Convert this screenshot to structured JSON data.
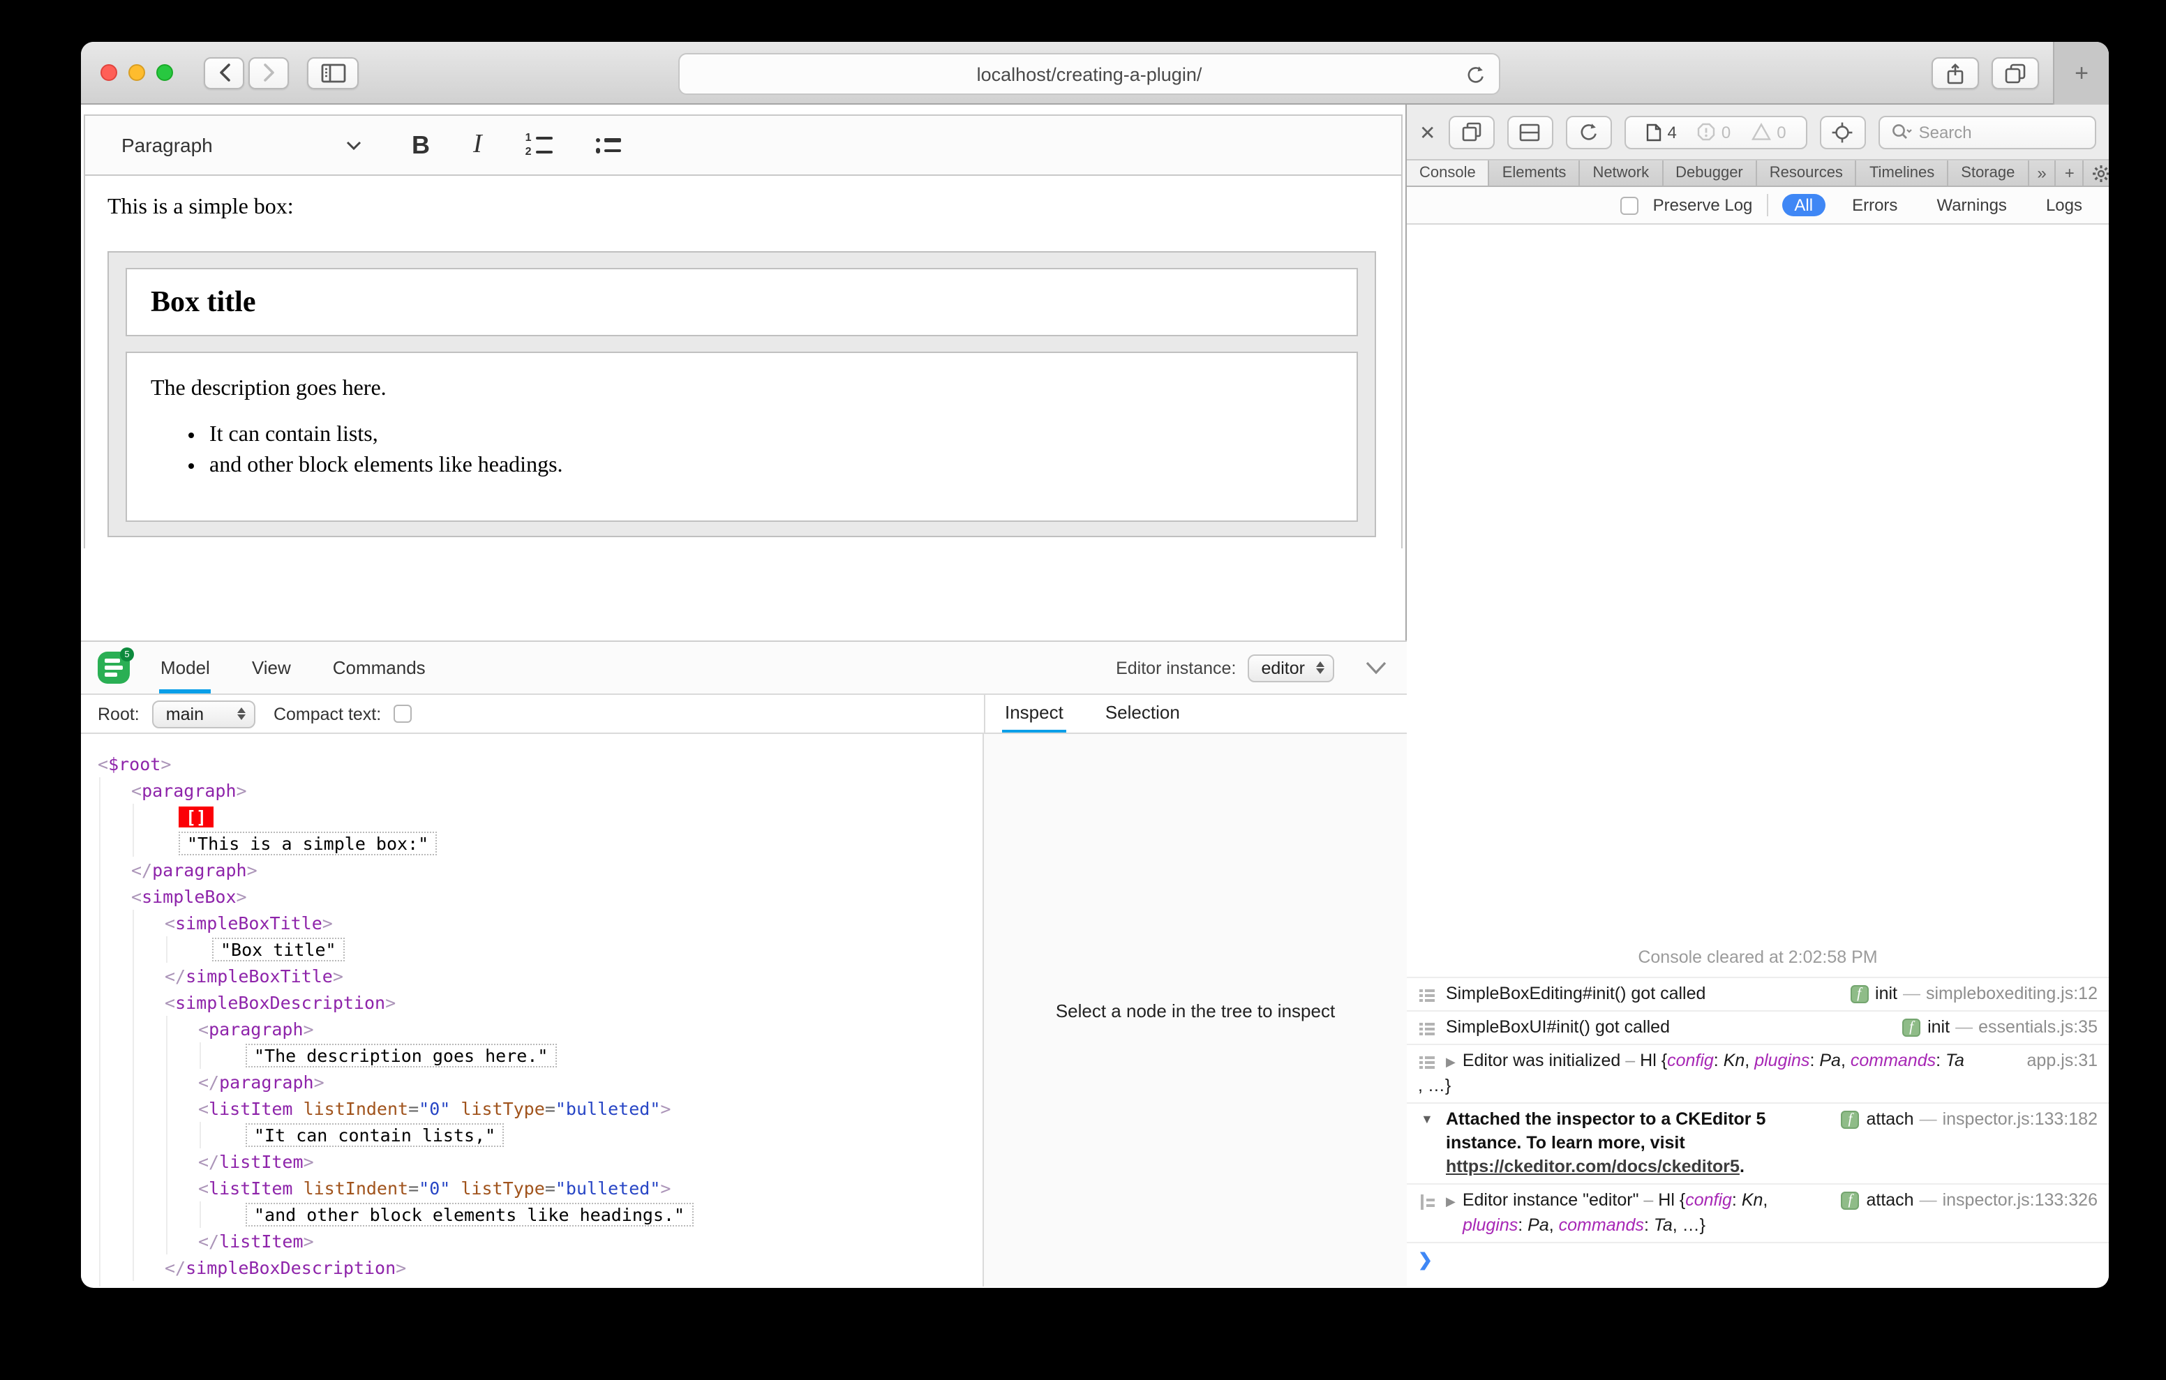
{
  "browser": {
    "url": "localhost/creating-a-plugin/",
    "new_tab_label": "+"
  },
  "editor": {
    "toolbar": {
      "paragraph_label": "Paragraph",
      "bold_label": "B",
      "italic_label": "I"
    },
    "content": {
      "intro": "This is a simple box:",
      "box_title": "Box title",
      "description": "The description goes here.",
      "bullets": [
        "It can contain lists,",
        "and other block elements like headings."
      ]
    }
  },
  "inspector": {
    "logo_badge": "5",
    "tabs": [
      {
        "label": "Model",
        "active": true
      },
      {
        "label": "View",
        "active": false
      },
      {
        "label": "Commands",
        "active": false
      }
    ],
    "editor_instance_label": "Editor instance:",
    "editor_instance_value": "editor",
    "root_label": "Root:",
    "root_value": "main",
    "compact_label": "Compact text:",
    "side_tabs": [
      {
        "label": "Inspect",
        "active": true
      },
      {
        "label": "Selection",
        "active": false
      }
    ],
    "empty_message": "Select a node in the tree to inspect",
    "tree": {
      "tag": "$root",
      "children": [
        {
          "tag": "paragraph",
          "children": [
            {
              "selection": "[]"
            },
            {
              "text": "\"This is a simple box:\""
            }
          ]
        },
        {
          "tag": "simpleBox",
          "children": [
            {
              "tag": "simpleBoxTitle",
              "children": [
                {
                  "text": "\"Box title\""
                }
              ]
            },
            {
              "tag": "simpleBoxDescription",
              "children": [
                {
                  "tag": "paragraph",
                  "children": [
                    {
                      "text": "\"The description goes here.\""
                    }
                  ]
                },
                {
                  "tag": "listItem",
                  "attrs": [
                    {
                      "name": "listIndent",
                      "value": "\"0\""
                    },
                    {
                      "name": "listType",
                      "value": "\"bulleted\""
                    }
                  ],
                  "children": [
                    {
                      "text": "\"It can contain lists,\""
                    }
                  ]
                },
                {
                  "tag": "listItem",
                  "attrs": [
                    {
                      "name": "listIndent",
                      "value": "\"0\""
                    },
                    {
                      "name": "listType",
                      "value": "\"bulleted\""
                    }
                  ],
                  "children": [
                    {
                      "text": "\"and other block elements like headings.\""
                    }
                  ]
                }
              ]
            }
          ]
        }
      ]
    }
  },
  "devtools": {
    "toolbar": {
      "page_count": "4",
      "error_count": "0",
      "warning_count": "0",
      "search_placeholder": "Search"
    },
    "tabs": [
      {
        "label": "Console",
        "active": true
      },
      {
        "label": "Elements",
        "active": false
      },
      {
        "label": "Network",
        "active": false
      },
      {
        "label": "Debugger",
        "active": false
      },
      {
        "label": "Resources",
        "active": false
      },
      {
        "label": "Timelines",
        "active": false
      },
      {
        "label": "Storage",
        "active": false
      }
    ],
    "overflow_label": "»",
    "add_tab_label": "+",
    "filters": {
      "preserve_label": "Preserve Log",
      "scopes": [
        {
          "label": "All",
          "active": true
        },
        {
          "label": "Errors",
          "active": false
        },
        {
          "label": "Warnings",
          "active": false
        },
        {
          "label": "Logs",
          "active": false
        }
      ]
    },
    "console": {
      "cleared": "Console cleared at 2:02:58 PM",
      "prompt": "❯",
      "entries": [
        {
          "icon": "log",
          "lines": [
            {
              "ind": 0,
              "segs": [
                {
                  "s": "plain",
                  "t": "SimpleBoxEditing#init() got called"
                }
              ]
            }
          ],
          "right": {
            "badge": "f",
            "label": "init",
            "loc": "simpleboxediting.js:12"
          }
        },
        {
          "icon": "log",
          "lines": [
            {
              "ind": 0,
              "segs": [
                {
                  "s": "plain",
                  "t": "SimpleBoxUI#init() got called"
                }
              ]
            }
          ],
          "right": {
            "badge": "f",
            "label": "init",
            "loc": "essentials.js:35"
          }
        },
        {
          "icon": "log",
          "disclosure": "collapsed",
          "lines": [
            {
              "ind": 0,
              "segs": [
                {
                  "s": "plain",
                  "t": "Editor was initialized"
                },
                {
                  "s": "dash",
                  "t": " – "
                },
                {
                  "s": "obj",
                  "t": "Hl {"
                },
                {
                  "s": "key",
                  "t": "config"
                },
                {
                  "s": "obj",
                  "t": ": "
                },
                {
                  "s": "ital",
                  "t": "Kn"
                },
                {
                  "s": "obj",
                  "t": ", "
                },
                {
                  "s": "key",
                  "t": "plugins"
                },
                {
                  "s": "obj",
                  "t": ": "
                },
                {
                  "s": "ital",
                  "t": "Pa"
                },
                {
                  "s": "obj",
                  "t": ", "
                },
                {
                  "s": "key",
                  "t": "commands"
                },
                {
                  "s": "obj",
                  "t": ": "
                },
                {
                  "s": "ital",
                  "t": "Ta"
                }
              ]
            },
            {
              "ind": -1,
              "segs": [
                {
                  "s": "obj",
                  "t": ", …}"
                }
              ]
            }
          ],
          "right": {
            "loc": "app.js:31"
          }
        },
        {
          "icon": "open",
          "lines": [
            {
              "ind": 0,
              "segs": [
                {
                  "s": "bold",
                  "t": "Attached the inspector to a CKEditor 5"
                }
              ]
            },
            {
              "ind": 0,
              "segs": [
                {
                  "s": "bold",
                  "t": "instance. To learn more, visit"
                }
              ]
            },
            {
              "ind": 0,
              "segs": [
                {
                  "s": "boldlink",
                  "t": "https://ckeditor.com/docs/ckeditor5"
                },
                {
                  "s": "bold",
                  "t": "."
                }
              ]
            }
          ],
          "right": {
            "badge": "f",
            "label": "attach",
            "loc": "inspector.js:133:182"
          }
        },
        {
          "icon": "nest",
          "disclosure": "collapsed",
          "lines": [
            {
              "ind": 0,
              "segs": [
                {
                  "s": "plain",
                  "t": "Editor instance \"editor\""
                },
                {
                  "s": "dash",
                  "t": " – "
                },
                {
                  "s": "obj",
                  "t": "Hl {"
                },
                {
                  "s": "key",
                  "t": "config"
                },
                {
                  "s": "obj",
                  "t": ": "
                },
                {
                  "s": "ital",
                  "t": "Kn"
                },
                {
                  "s": "obj",
                  "t": ","
                }
              ]
            },
            {
              "ind": 1,
              "segs": [
                {
                  "s": "key",
                  "t": "plugins"
                },
                {
                  "s": "obj",
                  "t": ": "
                },
                {
                  "s": "ital",
                  "t": "Pa"
                },
                {
                  "s": "obj",
                  "t": ", "
                },
                {
                  "s": "key",
                  "t": "commands"
                },
                {
                  "s": "obj",
                  "t": ": "
                },
                {
                  "s": "ital",
                  "t": "Ta"
                },
                {
                  "s": "obj",
                  "t": ", …}"
                }
              ]
            }
          ],
          "right": {
            "badge": "f",
            "label": "attach",
            "loc": "inspector.js:133:326"
          }
        }
      ]
    }
  },
  "colors": {
    "accent_blue": "#0b9fe8",
    "safari_blue": "#3f87f5",
    "tag_purple": "#8e24aa",
    "attr_orange": "#a0531c",
    "value_blue": "#2745c5",
    "selection_red": "#fb0007",
    "badge_green": "#8fbc88",
    "ck_green": "#2aaf54"
  }
}
